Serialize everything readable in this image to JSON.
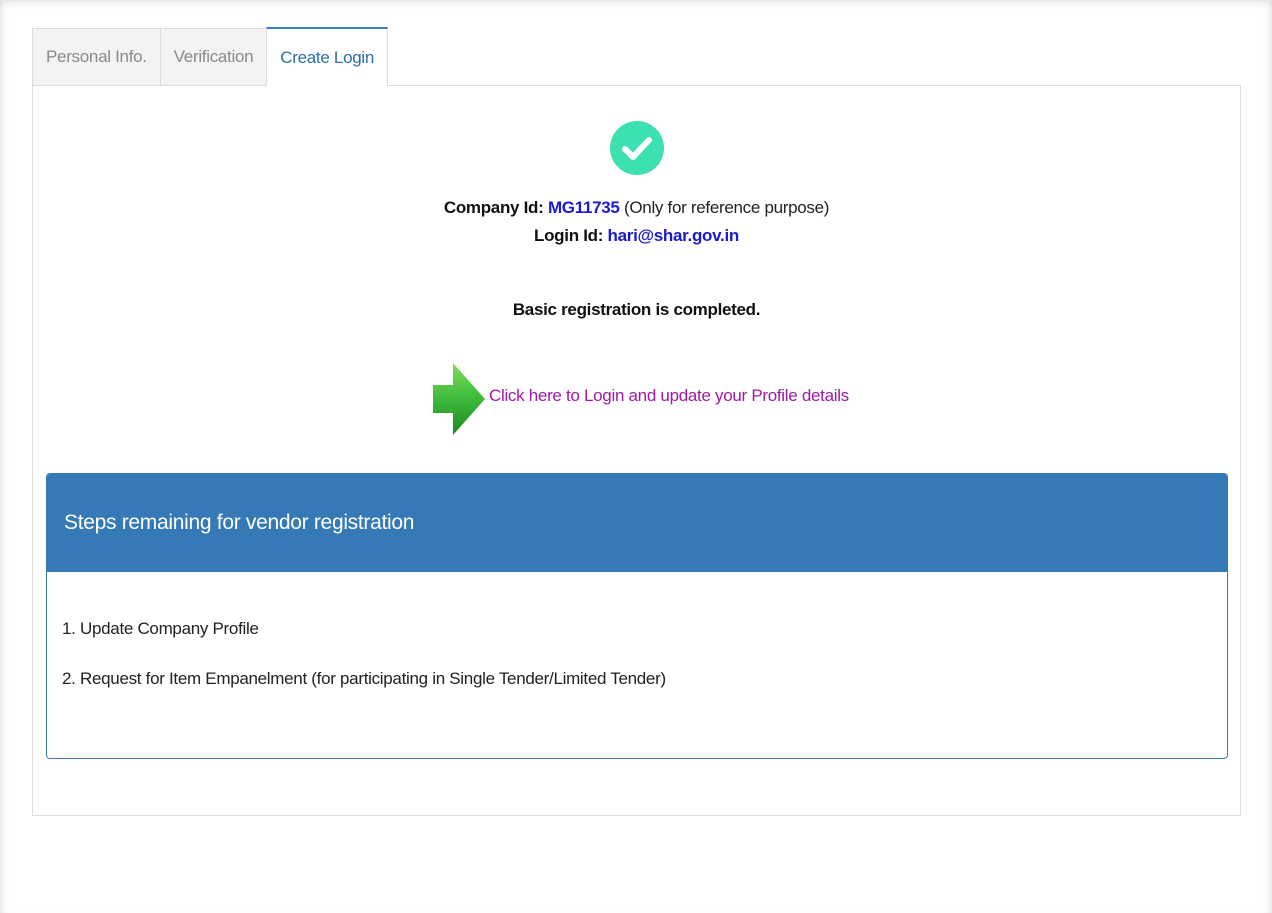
{
  "tabs": [
    {
      "label": "Personal Info.",
      "active": false
    },
    {
      "label": "Verification",
      "active": false
    },
    {
      "label": "Create Login",
      "active": true
    }
  ],
  "status_icon": "check-circle-icon",
  "company": {
    "label": "Company Id:",
    "value": "MG11735",
    "note": "(Only for reference purpose)"
  },
  "login": {
    "label": "Login Id:",
    "value": "hari@shar.gov.in"
  },
  "message": "Basic registration is completed.",
  "login_link": {
    "icon": "green-arrow-right-icon",
    "text": "Click here to Login and update your Profile details"
  },
  "steps_panel": {
    "title": "Steps remaining for vendor registration",
    "items": [
      "1. Update Company Profile",
      "2. Request for Item Empanelment (for participating in Single Tender/Limited Tender)"
    ]
  },
  "colors": {
    "accent_blue": "#3579b7",
    "success_green": "#3de0b0",
    "link_purple": "#a01aa8",
    "id_blue": "#1a1ad0"
  }
}
